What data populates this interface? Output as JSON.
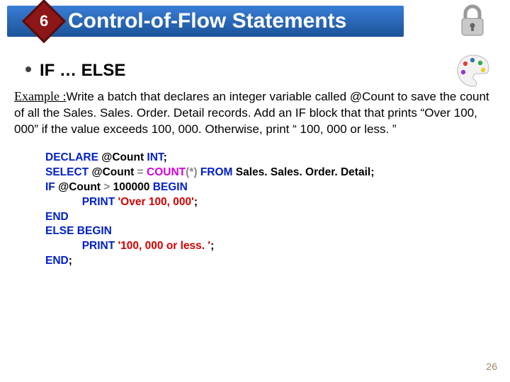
{
  "header": {
    "badge_number": "6",
    "title": "Control-of-Flow Statements"
  },
  "section": {
    "heading": "IF … ELSE"
  },
  "example": {
    "label": "Example :",
    "text": "Write a batch that declares an integer variable called @Count to save the count of all the Sales. Sales. Order. Detail records. Add an IF block that that prints “Over 100, 000” if the value exceeds 100, 000. Otherwise, print “ 100, 000 or less. ”"
  },
  "code": {
    "l1_kw1": "DECLARE",
    "l1_tok2": " @Count ",
    "l1_kw3": "INT",
    "l1_tok4": ";",
    "l2_kw1": "SELECT",
    "l2_tok2": " @Count ",
    "l2_op": "=",
    "l2_sp": " ",
    "l2_func": "COUNT",
    "l2_p_open": "(",
    "l2_star": "*",
    "l2_p_close": ")",
    "l2_kw2": " FROM",
    "l2_tok3": " Sales. Sales. Order. Detail",
    "l2_tok4": ";",
    "l3_kw1": "IF",
    "l3_tok2": " @Count ",
    "l3_op": ">",
    "l3_tok3": " 100000 ",
    "l3_kw2": "BEGIN",
    "l4_indent": "            ",
    "l4_kw1": "PRINT ",
    "l4_str": "'Over 100, 000'",
    "l4_tok": ";",
    "l5_kw1": "END",
    "l6_kw1": "ELSE BEGIN",
    "l7_indent": "            ",
    "l7_kw1": "PRINT ",
    "l7_str": "'100, 000 or less. '",
    "l7_tok": ";",
    "l8_kw1": "END",
    "l8_tok": ";"
  },
  "page_number": "26",
  "icons": {
    "lock": "lock-icon",
    "palette": "palette-icon"
  }
}
